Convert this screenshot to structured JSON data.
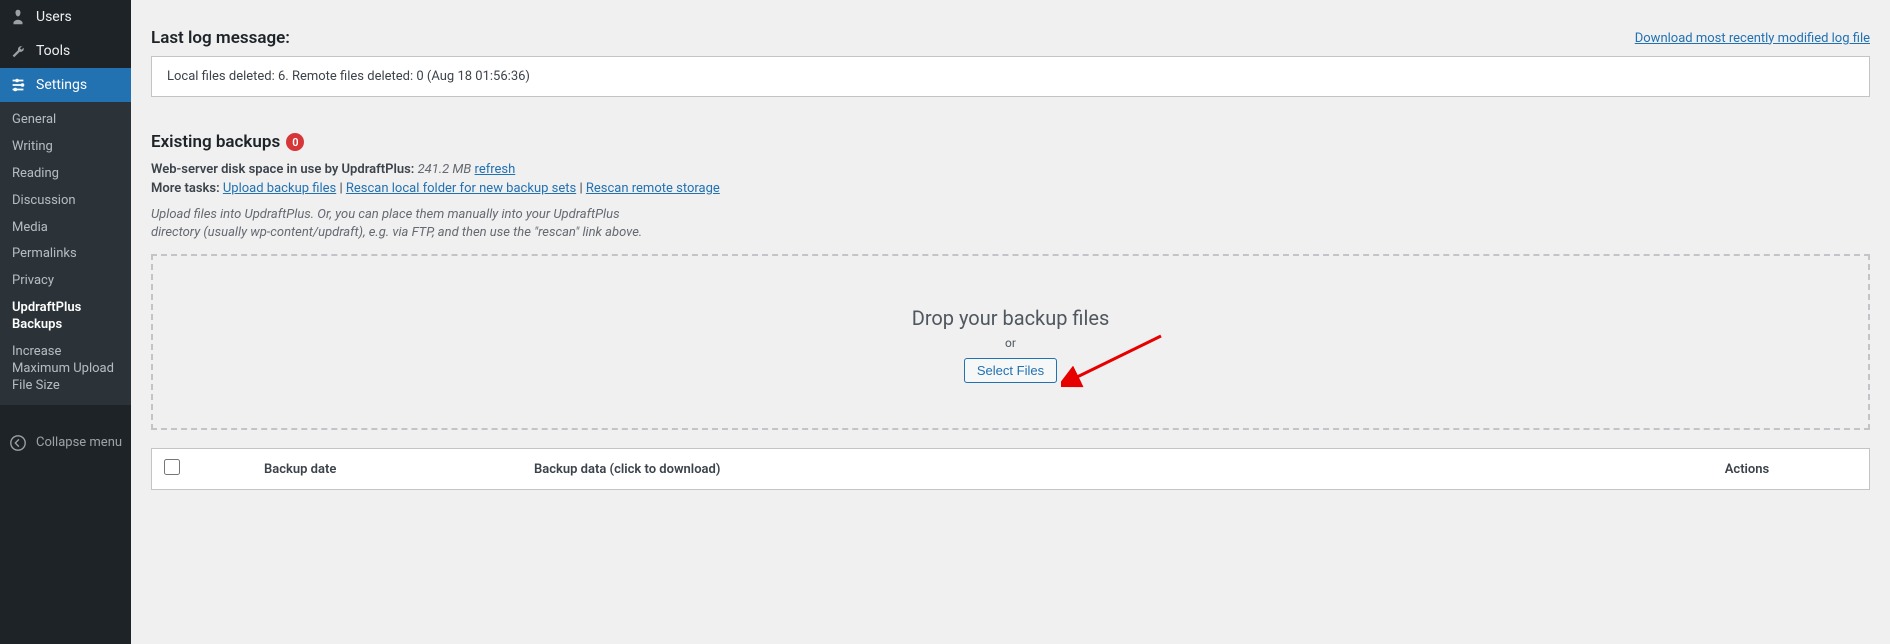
{
  "sidebar": {
    "top": [
      {
        "label": "Users",
        "icon": "user"
      },
      {
        "label": "Tools",
        "icon": "wrench"
      },
      {
        "label": "Settings",
        "icon": "sliders",
        "active": true
      }
    ],
    "subitems": [
      {
        "label": "General"
      },
      {
        "label": "Writing"
      },
      {
        "label": "Reading"
      },
      {
        "label": "Discussion"
      },
      {
        "label": "Media"
      },
      {
        "label": "Permalinks"
      },
      {
        "label": "Privacy"
      },
      {
        "label": "UpdraftPlus Backups",
        "current": true
      },
      {
        "label": "Increase Maximum Upload File Size"
      }
    ],
    "collapse_label": "Collapse menu"
  },
  "log": {
    "title": "Last log message:",
    "download_link": "Download most recently modified log file",
    "message": "Local files deleted: 6. Remote files deleted: 0 (Aug 18 01:56:36)"
  },
  "existing": {
    "title": "Existing backups",
    "count": "0",
    "disk_label": "Web-server disk space in use by UpdraftPlus:",
    "disk_value": "241.2 MB",
    "refresh": "refresh",
    "more_tasks_label": "More tasks:",
    "task_upload": "Upload backup files",
    "task_rescan_local": "Rescan local folder for new backup sets",
    "task_rescan_remote": "Rescan remote storage",
    "hint": "Upload files into UpdraftPlus. Or, you can place them manually into your UpdraftPlus directory (usually wp-content/updraft), e.g. via FTP, and then use the \"rescan\" link above."
  },
  "dropzone": {
    "title": "Drop your backup files",
    "or": "or",
    "button": "Select Files"
  },
  "table": {
    "col_date": "Backup date",
    "col_data": "Backup data (click to download)",
    "col_actions": "Actions"
  }
}
